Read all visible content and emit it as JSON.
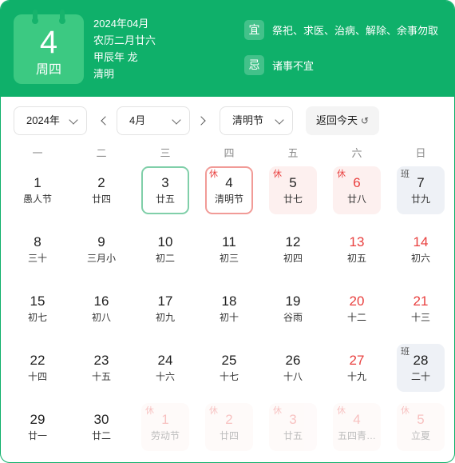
{
  "header": {
    "day_number": "4",
    "weekday": "周四",
    "date_line": "2024年04月",
    "lunar_line": "农历二月廿六",
    "ganzhi_line": "甲辰年 龙",
    "term_line": "清明",
    "yi_label": "宜",
    "yi_text": "祭祀、求医、治病、解除、余事勿取",
    "ji_label": "忌",
    "ji_text": "诸事不宜"
  },
  "toolbar": {
    "year_value": "2024年",
    "month_value": "4月",
    "holiday_value": "清明节",
    "today_label": "返回今天",
    "today_icon": "↺"
  },
  "weekdays": [
    "一",
    "二",
    "三",
    "四",
    "五",
    "六",
    "日"
  ],
  "days": [
    {
      "num": "1",
      "lunar": "愚人节",
      "type": "normal"
    },
    {
      "num": "2",
      "lunar": "廿四",
      "type": "normal"
    },
    {
      "num": "3",
      "lunar": "廿五",
      "type": "today"
    },
    {
      "num": "4",
      "lunar": "清明节",
      "type": "selected",
      "badge": "休"
    },
    {
      "num": "5",
      "lunar": "廿七",
      "type": "holiday",
      "badge": "休",
      "black": true
    },
    {
      "num": "6",
      "lunar": "廿八",
      "type": "holiday",
      "badge": "休"
    },
    {
      "num": "7",
      "lunar": "廿九",
      "type": "work",
      "badge": "班"
    },
    {
      "num": "8",
      "lunar": "三十",
      "type": "normal"
    },
    {
      "num": "9",
      "lunar": "三月小",
      "type": "normal"
    },
    {
      "num": "10",
      "lunar": "初二",
      "type": "normal"
    },
    {
      "num": "11",
      "lunar": "初三",
      "type": "normal"
    },
    {
      "num": "12",
      "lunar": "初四",
      "type": "normal"
    },
    {
      "num": "13",
      "lunar": "初五",
      "type": "weekend"
    },
    {
      "num": "14",
      "lunar": "初六",
      "type": "weekend"
    },
    {
      "num": "15",
      "lunar": "初七",
      "type": "normal"
    },
    {
      "num": "16",
      "lunar": "初八",
      "type": "normal"
    },
    {
      "num": "17",
      "lunar": "初九",
      "type": "normal"
    },
    {
      "num": "18",
      "lunar": "初十",
      "type": "normal"
    },
    {
      "num": "19",
      "lunar": "谷雨",
      "type": "normal"
    },
    {
      "num": "20",
      "lunar": "十二",
      "type": "weekend"
    },
    {
      "num": "21",
      "lunar": "十三",
      "type": "weekend"
    },
    {
      "num": "22",
      "lunar": "十四",
      "type": "normal"
    },
    {
      "num": "23",
      "lunar": "十五",
      "type": "normal"
    },
    {
      "num": "24",
      "lunar": "十六",
      "type": "normal"
    },
    {
      "num": "25",
      "lunar": "十七",
      "type": "normal"
    },
    {
      "num": "26",
      "lunar": "十八",
      "type": "normal"
    },
    {
      "num": "27",
      "lunar": "十九",
      "type": "weekend"
    },
    {
      "num": "28",
      "lunar": "二十",
      "type": "work",
      "badge": "班"
    },
    {
      "num": "29",
      "lunar": "廿一",
      "type": "normal"
    },
    {
      "num": "30",
      "lunar": "廿二",
      "type": "normal"
    },
    {
      "num": "1",
      "lunar": "劳动节",
      "type": "holiday",
      "badge": "休",
      "other": true
    },
    {
      "num": "2",
      "lunar": "廿四",
      "type": "holiday",
      "badge": "休",
      "other": true
    },
    {
      "num": "3",
      "lunar": "廿五",
      "type": "holiday",
      "badge": "休",
      "other": true
    },
    {
      "num": "4",
      "lunar": "五四青…",
      "type": "holiday",
      "badge": "休",
      "other": true
    },
    {
      "num": "5",
      "lunar": "立夏",
      "type": "holiday",
      "badge": "休",
      "other": true
    }
  ],
  "colors": {
    "brand_green": "#0fb06a",
    "holiday_red": "#e9403f",
    "holiday_bg": "#fdf0ef",
    "workday_bg": "#eef1f6",
    "today_border": "#80cfa9",
    "selected_border": "#f19b97"
  }
}
